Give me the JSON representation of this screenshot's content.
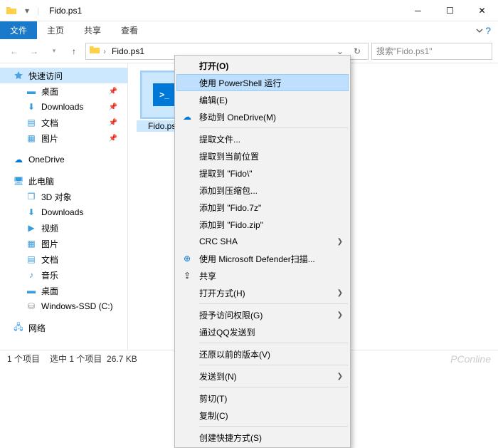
{
  "titlebar": {
    "title": "Fido.ps1"
  },
  "ribbon": {
    "file": "文件",
    "home": "主页",
    "share": "共享",
    "view": "查看"
  },
  "address": {
    "crumb": "Fido.ps1"
  },
  "search": {
    "placeholder": "搜索\"Fido.ps1\""
  },
  "sidebar": {
    "quick": "快速访问",
    "desktop": "桌面",
    "downloads": "Downloads",
    "documents": "文档",
    "pictures": "图片",
    "onedrive": "OneDrive",
    "thispc": "此电脑",
    "objs3d": "3D 对象",
    "pc_downloads": "Downloads",
    "videos": "视频",
    "pc_pictures": "图片",
    "pc_documents": "文档",
    "music": "音乐",
    "pc_desktop": "桌面",
    "drive_c": "Windows-SSD (C:)",
    "network": "网络"
  },
  "file": {
    "name": "Fido.ps1"
  },
  "context": {
    "open": "打开(O)",
    "run_ps": "使用 PowerShell 运行",
    "edit": "编辑(E)",
    "move_od": "移动到 OneDrive(M)",
    "extract_files": "提取文件...",
    "extract_here": "提取到当前位置",
    "extract_to": "提取到 \"Fido\\\"",
    "add_archive": "添加到压缩包...",
    "add_7z": "添加到 \"Fido.7z\"",
    "add_zip": "添加到 \"Fido.zip\"",
    "crc": "CRC SHA",
    "defender": "使用 Microsoft Defender扫描...",
    "share": "共享",
    "open_with": "打开方式(H)",
    "grant_access": "授予访问权限(G)",
    "qq_send": "通过QQ发送到",
    "restore": "还原以前的版本(V)",
    "send_to": "发送到(N)",
    "cut": "剪切(T)",
    "copy": "复制(C)",
    "create_shortcut": "创建快捷方式(S)"
  },
  "status": {
    "count": "1 个项目",
    "selected": "选中 1 个项目",
    "size": "26.7 KB"
  },
  "watermark": "PConline"
}
